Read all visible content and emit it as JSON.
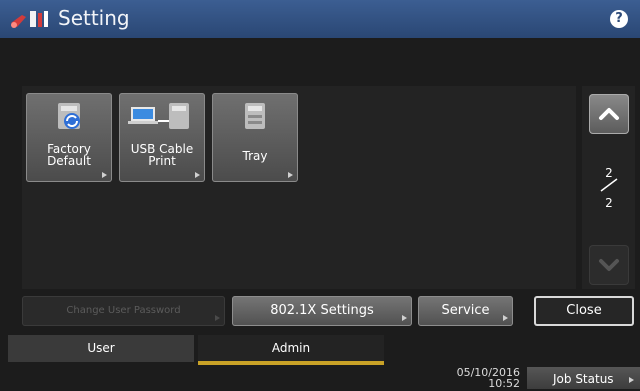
{
  "header": {
    "title": "Setting",
    "help_label": "?",
    "app_icon": "wrench-printer-icon"
  },
  "tiles": [
    {
      "label": "Factory\nDefault",
      "icon": "factory-reset-icon"
    },
    {
      "label": "USB Cable\nPrint",
      "icon": "usb-laptop-printer-icon"
    },
    {
      "label": "Tray",
      "icon": "printer-tray-icon"
    }
  ],
  "pager": {
    "current": "2",
    "total": "2"
  },
  "buttons": {
    "change_password": "Change User Password",
    "settings_8021x": "802.1X Settings",
    "service": "Service",
    "close": "Close"
  },
  "tabs": {
    "user": "User",
    "admin": "Admin",
    "active": "Admin"
  },
  "status": {
    "date": "05/10/2016",
    "time": "10:52",
    "job_status": "Job Status"
  },
  "colors": {
    "title_bar": "#34548a",
    "accent": "#c9a227",
    "background": "#1c1c1c"
  }
}
